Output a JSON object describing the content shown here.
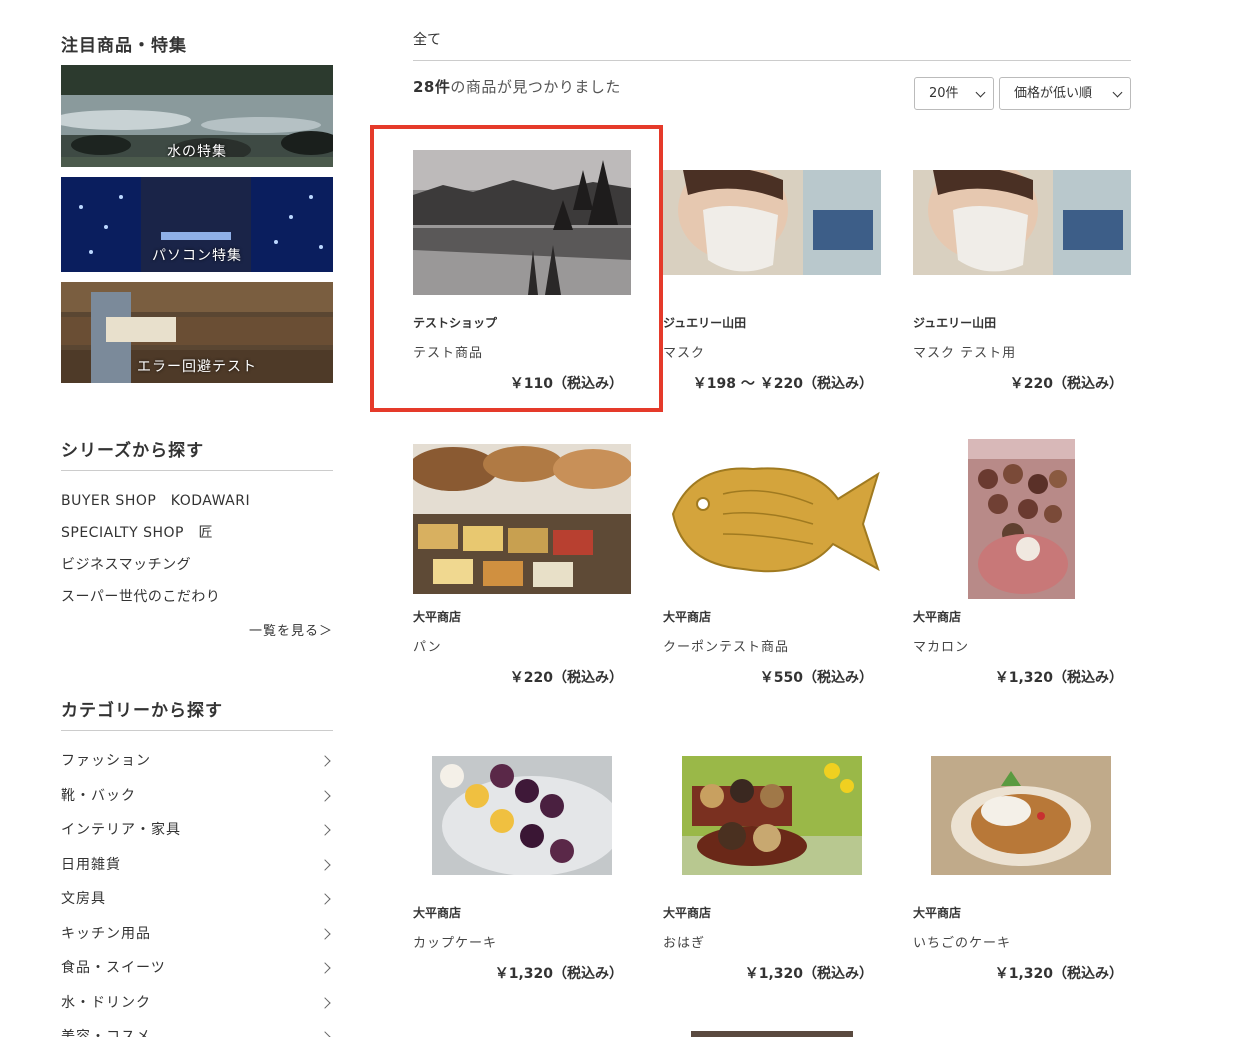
{
  "sidebar": {
    "featured_title": "注目商品・特集",
    "banners": [
      {
        "label": "水の特集"
      },
      {
        "label": "パソコン特集"
      },
      {
        "label": "エラー回避テスト"
      }
    ],
    "series_title": "シリーズから探す",
    "series": [
      "BUYER SHOP　KODAWARI",
      "SPECIALTY SHOP　匠",
      "ビジネスマッチング",
      "スーパー世代のこだわり"
    ],
    "series_more": "一覧を見る＞",
    "category_title": "カテゴリーから探す",
    "categories": [
      "ファッション",
      "靴・バック",
      "インテリア・家具",
      "日用雑貨",
      "文房具",
      "キッチン用品",
      "食品・スイーツ",
      "水・ドリンク",
      "美容・コスメ"
    ]
  },
  "main": {
    "breadcrumb": "全て",
    "count_number": "28件",
    "count_text": "の商品が見つかりました",
    "per_page": "20件",
    "sort": "価格が低い順",
    "products": [
      {
        "shop": "テストショップ",
        "name": "テスト商品",
        "price": "￥110（税込み）"
      },
      {
        "shop": "ジュエリー山田",
        "name": "マスク",
        "price": "￥198 〜 ￥220（税込み）"
      },
      {
        "shop": "ジュエリー山田",
        "name": "マスク テスト用",
        "price": "￥220（税込み）"
      },
      {
        "shop": "大平商店",
        "name": "パン",
        "price": "￥220（税込み）"
      },
      {
        "shop": "大平商店",
        "name": "クーポンテスト商品",
        "price": "￥550（税込み）"
      },
      {
        "shop": "大平商店",
        "name": "マカロン",
        "price": "￥1,320（税込み）"
      },
      {
        "shop": "大平商店",
        "name": "カップケーキ",
        "price": "￥1,320（税込み）"
      },
      {
        "shop": "大平商店",
        "name": "おはぎ",
        "price": "￥1,320（税込み）"
      },
      {
        "shop": "大平商店",
        "name": "いちごのケーキ",
        "price": "￥1,320（税込み）"
      }
    ]
  },
  "colors": {
    "highlight": "#e53a2a",
    "rule": "#cccccc",
    "text": "#333333"
  }
}
